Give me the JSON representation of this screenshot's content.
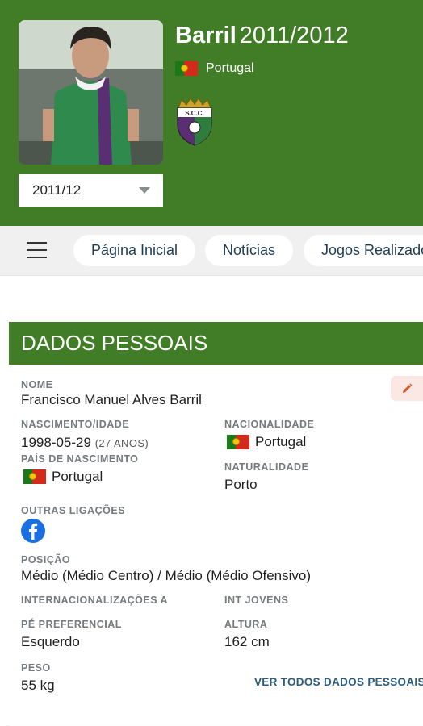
{
  "header": {
    "player_name": "Barril",
    "season_title": "2011/2012",
    "country": "Portugal",
    "club_crest_text": "S.C.C.",
    "season_select_value": "2011/12"
  },
  "nav": {
    "tabs": [
      {
        "label": "Página Inicial"
      },
      {
        "label": "Notícias"
      },
      {
        "label": "Jogos Realizados"
      }
    ]
  },
  "section": {
    "title": "DADOS PESSOAIS"
  },
  "personal": {
    "nome_label": "NOME",
    "nome_value": "Francisco Manuel Alves Barril",
    "nascimento_label": "NASCIMENTO/IDADE",
    "nascimento_value": "1998-05-29",
    "idade_value": "(27 ANOS)",
    "nacionalidade_label": "NACIONALIDADE",
    "nacionalidade_value": "Portugal",
    "pais_label": "PAÍS DE NASCIMENTO",
    "pais_value": "Portugal",
    "naturalidade_label": "NATURALIDADE",
    "naturalidade_value": "Porto",
    "outras_label": "OUTRAS LIGAÇÕES",
    "posicao_label": "POSIÇÃO",
    "posicao_value": "Médio (Médio Centro) / Médio (Médio Ofensivo)",
    "internacionalizacoes_label": "INTERNACIONALIZAÇÕES A",
    "int_jovens_label": "INT JOVENS",
    "pe_label": "PÉ PREFERENCIAL",
    "pe_value": "Esquerdo",
    "altura_label": "ALTURA",
    "altura_value": "162 cm",
    "peso_label": "PESO",
    "peso_value": "55 kg",
    "ver_todos": "VER TODOS DADOS PESSOAIS >"
  },
  "colors": {
    "brand_green": "#417d27",
    "link_blue": "#2b5c7e",
    "facebook_blue": "#1b6fe0",
    "edit_orange": "#d9592c"
  },
  "icons": [
    "menu-icon",
    "chevron-down-icon",
    "portugal-flag-icon",
    "club-crest-icon",
    "pencil-icon",
    "facebook-icon"
  ]
}
